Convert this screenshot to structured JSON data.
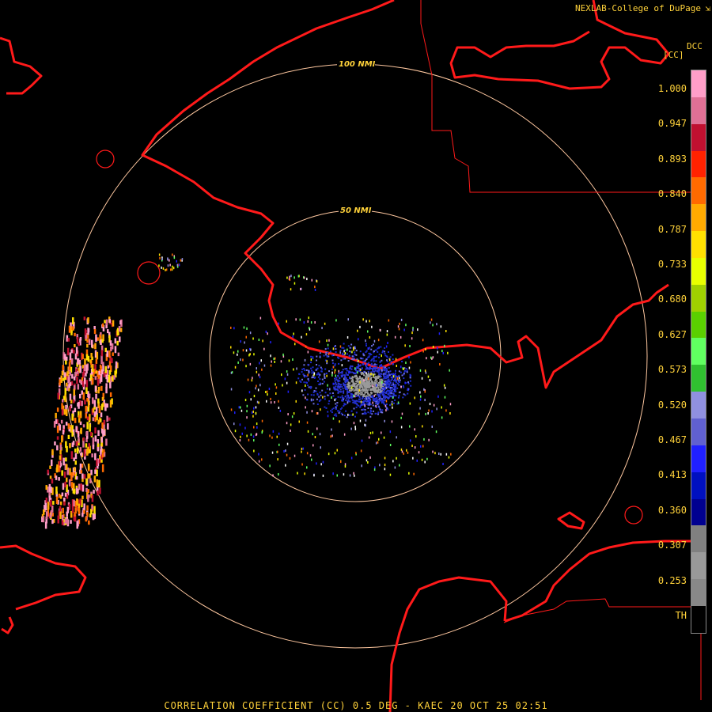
{
  "header": {
    "brand": "NEXLAB-College of DuPage",
    "brand_icon": "resize-corner-icon"
  },
  "legend": {
    "product_code": "DCC",
    "unit": "[CC]",
    "ticks": [
      "1.000",
      "0.947",
      "0.893",
      "0.840",
      "0.787",
      "0.733",
      "0.680",
      "0.627",
      "0.573",
      "0.520",
      "0.467",
      "0.413",
      "0.360",
      "0.307",
      "0.253",
      "TH"
    ],
    "colors": [
      "#ff9ec8",
      "#e07095",
      "#c01030",
      "#ff2200",
      "#ff6a00",
      "#ffaa00",
      "#ffe000",
      "#e8ff00",
      "#a0d000",
      "#5ad000",
      "#60ff60",
      "#30c030",
      "#9090e0",
      "#6060d0",
      "#2020ff",
      "#0010c0",
      "#000090",
      "#808080",
      "#999999",
      "#888888",
      "#000000"
    ]
  },
  "rings": {
    "inner_label": "50 NMI",
    "outer_label": "100 NMI"
  },
  "footer": {
    "caption": "CORRELATION COEFFICIENT (CC) 0.5 DEG - KAEC 20 OCT 25 02:51"
  },
  "colors": {
    "coastline": "#ff1a1a",
    "ring": "#ffc8a0",
    "text": "#ffd23a"
  }
}
